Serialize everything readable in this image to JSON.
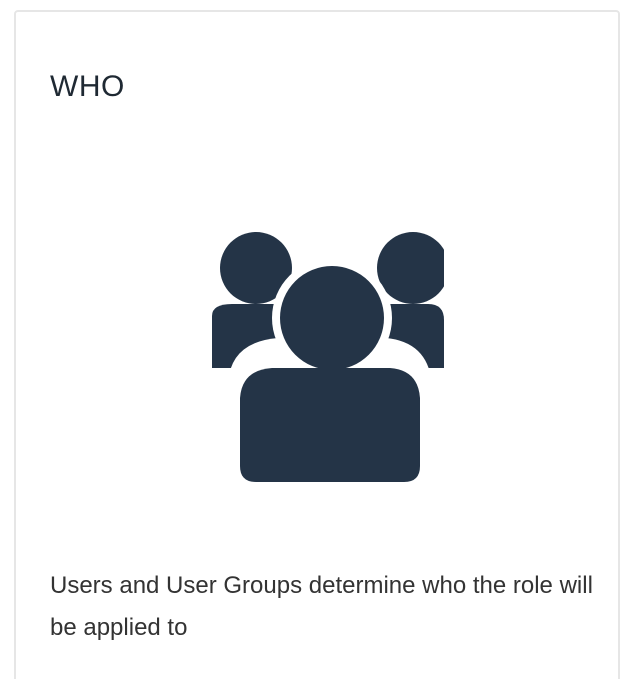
{
  "card": {
    "title": "WHO",
    "icon": "user-group-icon",
    "description": "Users and User Groups determine who the role will be applied to",
    "icon_color": "#243447"
  }
}
